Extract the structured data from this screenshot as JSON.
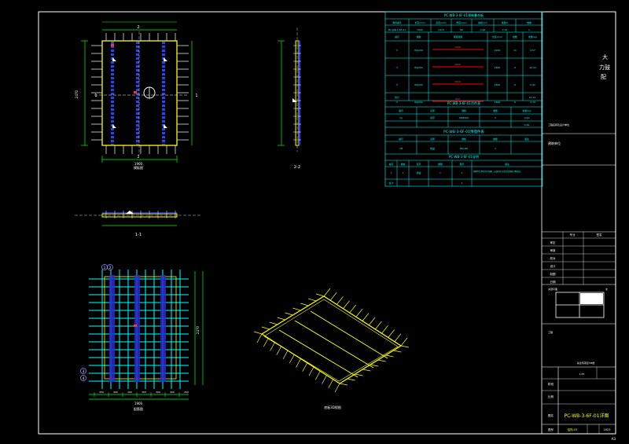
{
  "drawing": {
    "title": "PC-WB-3-6F-01详图",
    "views": {
      "plan_label": "模板图",
      "section_11_label": "1-1",
      "section_22_label": "2-2",
      "rebar_label": "配筋图",
      "iso_label": "底板3D视图"
    },
    "plan": {
      "dim_top": "2",
      "dim_bottom": "2",
      "dim_width": "1900",
      "dim_height": "2470",
      "mark_left": "1",
      "mark_right": "1",
      "mark_top": "2",
      "mark_bottom": "2"
    },
    "rebar": {
      "dims_bottom": [
        "250",
        "300",
        "300",
        "300",
        "300",
        "300",
        "250"
      ],
      "total_bottom": "1900",
      "side_dim": "2470",
      "bubbles": [
        "1",
        "2",
        "3",
        "4"
      ]
    },
    "component_table": {
      "title": "PC-WB-3-6F-01预制叠合板",
      "headers": [
        "构件编号",
        "长度(mm)",
        "宽度(mm)",
        "厚度(mm)",
        "体积(m³)",
        "重量(t)",
        "数量"
      ],
      "row": [
        "PC-WB-3-6F-01",
        "1900",
        "2470",
        "60",
        "0.28",
        "0.70",
        "1"
      ]
    },
    "rebar_table": {
      "title": "PC-WB-3-6F-01钢筋表",
      "headers": [
        "编号",
        "规格",
        "钢筋简图",
        "长度(mm)",
        "根数",
        "重量(kg)"
      ],
      "rows": [
        [
          "①",
          "8@200",
          "2200",
          "2200",
          "11",
          "9.57"
        ],
        [
          "②",
          "8@200",
          "2800",
          "2800",
          "9",
          "10.04"
        ],
        [
          "③",
          "8@200",
          "2500",
          "2500",
          "6",
          "5.92"
        ],
        [
          "④",
          "8@200",
          "600",
          "1600",
          "6",
          "3.79"
        ]
      ],
      "total_label": "合计",
      "total": "29.32"
    },
    "lifting_table": {
      "title": "PC-WB-3-6F-01吊件表",
      "headers": [
        "编号",
        "名称",
        "规格",
        "数量",
        "重量(kg)"
      ],
      "row": [
        "DJ",
        "吊环",
        "HPB300",
        "4",
        "0.29"
      ],
      "total": "0.29"
    },
    "embedded_table": {
      "title": "PC-WB-3-6F-01预埋件表",
      "headers": [
        "编号",
        "名称",
        "规格",
        "数量",
        "备注"
      ],
      "row": [
        "YM",
        "线盒",
        "86×86",
        "1",
        ""
      ]
    },
    "notes_table": {
      "title": "PC-WB-3-6F-01说明",
      "headers": [
        "编号",
        "规格",
        "型号",
        "数量",
        "图号",
        "备注"
      ],
      "row": [
        "1",
        "1",
        "线盒",
        "1",
        "1",
        "预埋件位置详见平面图，安装时应与现浇层钢筋可靠连接。"
      ],
      "footer": [
        "合计",
        "",
        "",
        "",
        "1",
        ""
      ]
    },
    "title_block": {
      "company_lines": [
        "大",
        "力鼓",
        "配"
      ],
      "stamp_text": "工程名称及设计单位",
      "section_label": "建筑单位",
      "sign_headers": [
        "专业",
        "签名"
      ],
      "sign_rows": [
        "审定",
        "审核",
        "校对",
        "设计",
        "制图",
        "日期"
      ],
      "key_plan_label": "关键平面",
      "north_label": "北",
      "project_label": "工程",
      "project_name": "某住宅项目3#楼",
      "scale_label": "比例",
      "scale_value": "1:25",
      "drawing_name_label": "图名",
      "stage_label": "阶段",
      "drawing_no_label": "图号",
      "drawing_no": "结构-03",
      "date_value": "2023"
    },
    "corner_mark": "A3"
  },
  "colors": {
    "background": "#000000",
    "frame": "#ffffff",
    "slab_outline": "#ffff00",
    "rebar": "#00ffff",
    "rebar_dark": "#0000cc",
    "lifting": "#ff00ff",
    "dimension": "#00ff00",
    "rebar_shape": "#ff0000",
    "table_text": "#00ffff"
  }
}
